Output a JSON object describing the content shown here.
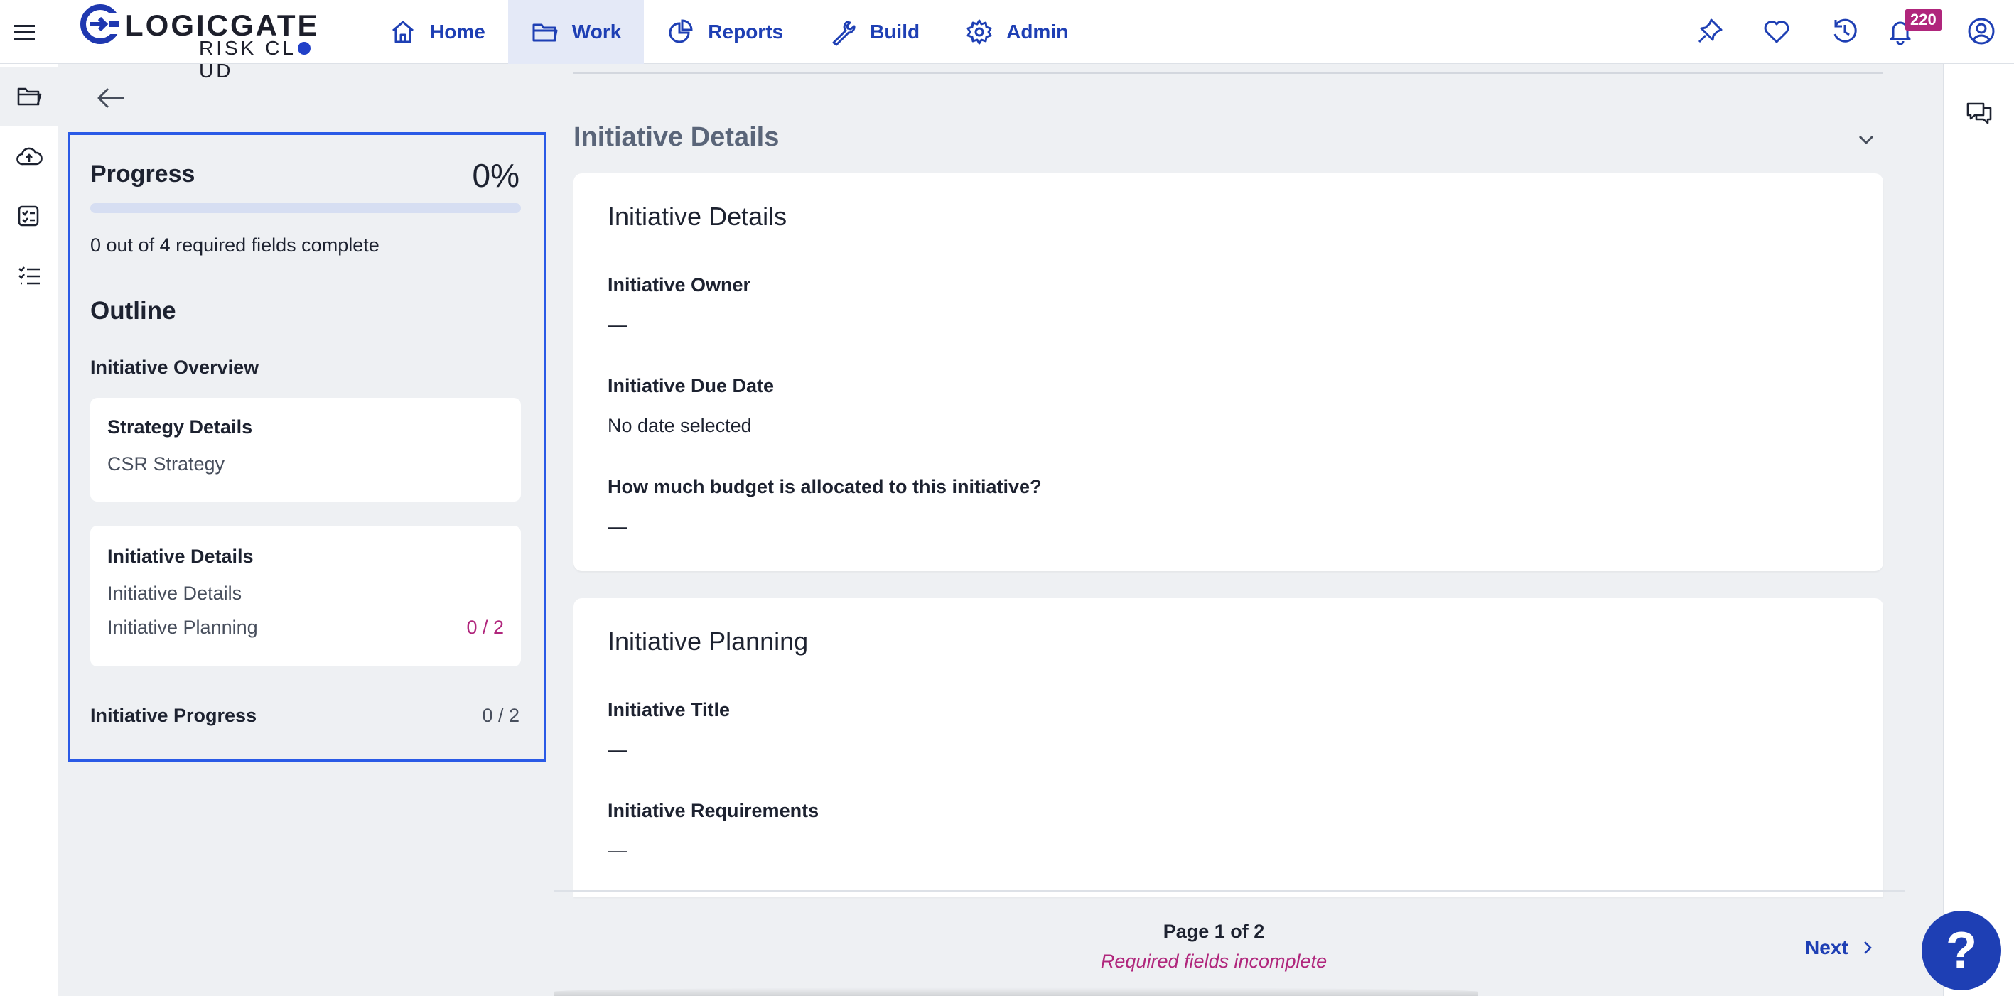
{
  "brand": {
    "name": "LOGICGATE",
    "sub_before": "RISK CL",
    "sub_after": "UD"
  },
  "nav": [
    {
      "label": "Home",
      "icon": "home-icon",
      "active": false
    },
    {
      "label": "Work",
      "icon": "folder-icon",
      "active": true
    },
    {
      "label": "Reports",
      "icon": "pie-chart-icon",
      "active": false
    },
    {
      "label": "Build",
      "icon": "wrench-icon",
      "active": false
    },
    {
      "label": "Admin",
      "icon": "gear-icon",
      "active": false
    }
  ],
  "topbar": {
    "notification_count": "220"
  },
  "progress": {
    "title": "Progress",
    "percent_label": "0%",
    "fraction": 0,
    "fields_text": "0 out of 4 required fields complete"
  },
  "outline": {
    "title": "Outline",
    "section_overview": "Initiative Overview",
    "card_strategy": {
      "title": "Strategy Details",
      "item": "CSR Strategy"
    },
    "card_initiative": {
      "title": "Initiative Details",
      "item1": "Initiative Details",
      "item2": "Initiative Planning",
      "item2_count": "0 / 2"
    },
    "section_progress": "Initiative Progress",
    "section_progress_count": "0 / 2"
  },
  "main": {
    "section_title": "Initiative Details",
    "details_card": {
      "heading": "Initiative Details",
      "owner_label": "Initiative Owner",
      "owner_value": "—",
      "due_label": "Initiative Due Date",
      "due_value": "No date selected",
      "budget_label": "How much budget is allocated to this initiative?",
      "budget_value": "—"
    },
    "planning_card": {
      "heading": "Initiative Planning",
      "title_label": "Initiative Title",
      "title_value": "—",
      "req_label": "Initiative Requirements",
      "req_value": "—"
    }
  },
  "footer": {
    "page_label": "Page 1 of 2",
    "warning": "Required fields incomplete",
    "next_label": "Next",
    "help_label": "?"
  },
  "colors": {
    "accent": "#1e3fb4",
    "highlight": "#2a5ae6",
    "warning": "#b0267c"
  }
}
